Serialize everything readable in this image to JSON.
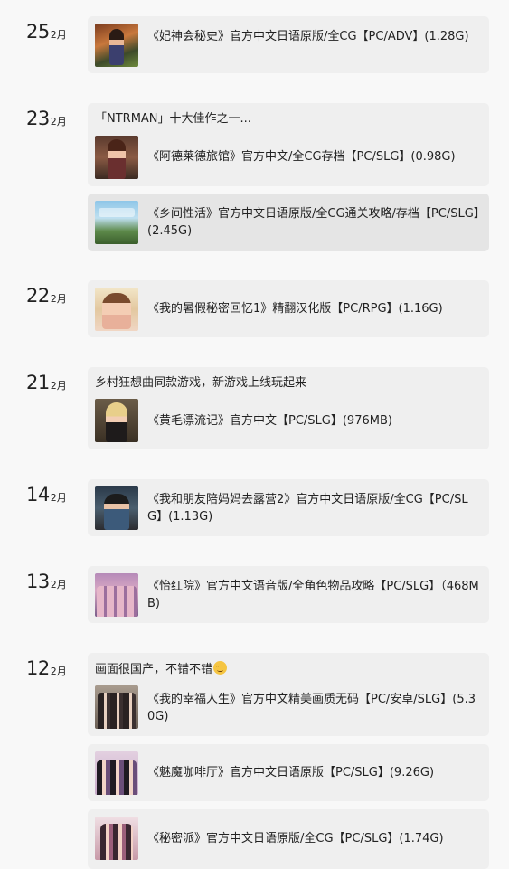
{
  "days": [
    {
      "day": "25",
      "month": "2月",
      "cards": [
        {
          "note": "",
          "title": "《妃神会秘史》官方中文日语原版/全CG【PC/ADV】(1.28G)",
          "thumb": "thumbnail-image"
        }
      ]
    },
    {
      "day": "23",
      "month": "2月",
      "cards": [
        {
          "note": "「NTRMAN」十大佳作之一...",
          "title": "《阿德莱德旅馆》官方中文/全CG存档【PC/SLG】(0.98G)",
          "thumb": "thumbnail-image"
        },
        {
          "note": "",
          "title": "《乡间性活》官方中文日语原版/全CG通关攻略/存档【PC/SLG】(2.45G)",
          "thumb": "thumbnail-image"
        }
      ]
    },
    {
      "day": "22",
      "month": "2月",
      "cards": [
        {
          "note": "",
          "title": "《我的暑假秘密回忆1》精翻汉化版【PC/RPG】(1.16G)",
          "thumb": "thumbnail-image"
        }
      ]
    },
    {
      "day": "21",
      "month": "2月",
      "cards": [
        {
          "note": "乡村狂想曲同款游戏，新游戏上线玩起来",
          "title": "《黄毛漂流记》官方中文【PC/SLG】(976MB)",
          "thumb": "thumbnail-image"
        }
      ]
    },
    {
      "day": "14",
      "month": "2月",
      "cards": [
        {
          "note": "",
          "title": "《我和朋友陪妈妈去露营2》官方中文日语原版/全CG【PC/SLG】(1.13G)",
          "thumb": "thumbnail-image"
        }
      ]
    },
    {
      "day": "13",
      "month": "2月",
      "cards": [
        {
          "note": "",
          "title": "《怡红院》官方中文语音版/全角色物品攻略【PC/SLG】（468MB)",
          "thumb": "thumbnail-image"
        }
      ]
    },
    {
      "day": "12",
      "month": "2月",
      "cards": [
        {
          "note": "画面很国产，不错不错",
          "note_icon": "smiling-emoji-icon",
          "title": "《我的幸福人生》官方中文精美画质无码【PC/安卓/SLG】(5.30G)",
          "thumb": "thumbnail-image"
        },
        {
          "note": "",
          "title": "《魅魔咖啡厅》官方中文日语原版【PC/SLG】(9.26G)",
          "thumb": "thumbnail-image"
        },
        {
          "note": "",
          "title": "《秘密派》官方中文日语原版/全CG【PC/SLG】(1.74G)",
          "thumb": "thumbnail-image"
        }
      ]
    }
  ]
}
